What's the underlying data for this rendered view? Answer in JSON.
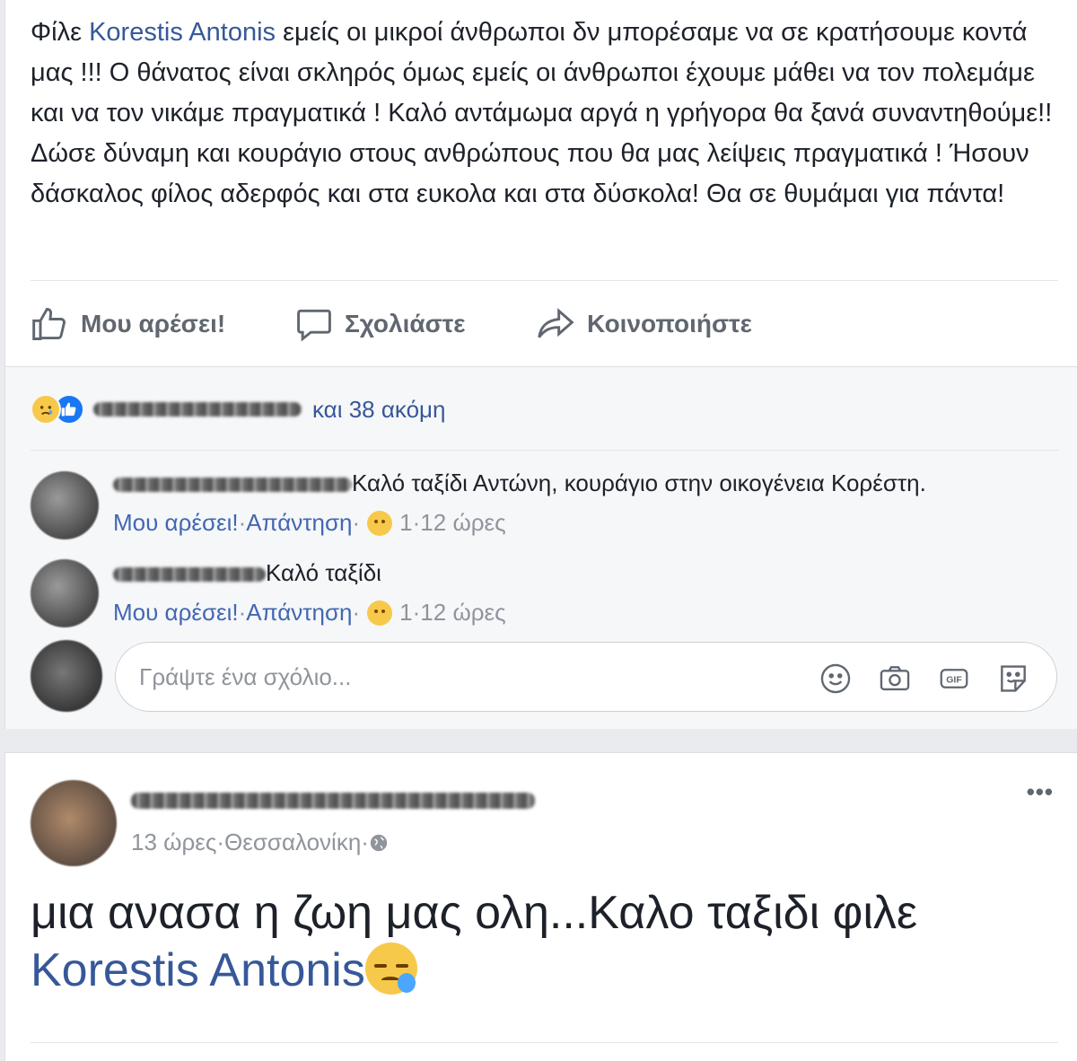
{
  "post1": {
    "text_prefix": "Φίλε ",
    "mention": "Korestis Antonis",
    "text_suffix": " εμείς οι μικροί άνθρωποι δν μπορέσαμε να σε κρατήσουμε κοντά μας !!! Ο θάνατος είναι σκληρός όμως εμείς οι άνθρωποι έχουμε μάθει να τον πολεμάμε και να τον νικάμε πραγματικά ! Καλό αντάμωμα αργά η γρήγορα θα ξανά συναντηθούμε!! Δώσε δύναμη και κουράγιο στους ανθρώπους που θα μας λείψεις πραγματικά ! Ήσουν δάσκαλος φίλος αδερφός και στα ευκολα και στα δύσκολα! Θα σε θυμάμαι για πάντα!",
    "actions": {
      "like": "Μου αρέσει!",
      "comment": "Σχολιάστε",
      "share": "Κοινοποιήστε"
    },
    "reactions_summary": "και 38 ακόμη",
    "comments": [
      {
        "text": "Καλό ταξίδι Αντώνη, κουράγιο στην οικογένεια Κορέστη.",
        "like_label": "Μου αρέσει!",
        "reply_label": "Απάντηση",
        "reaction_count": "1",
        "time": "12 ώρες"
      },
      {
        "text": "Καλό ταξίδι",
        "like_label": "Μου αρέσει!",
        "reply_label": "Απάντηση",
        "reaction_count": "1",
        "time": "12 ώρες"
      }
    ],
    "composer_placeholder": "Γράψτε ένα σχόλιο..."
  },
  "post2": {
    "time": "13 ώρες",
    "location": "Θεσσαλονίκη",
    "text": "μια ανασα η ζωη μας ολη...Καλο ταξιδι φιλε ",
    "mention": "Korestis Antonis",
    "more_label": "•••"
  },
  "separator": " · ",
  "colors": {
    "link": "#365899",
    "meta": "#90949c",
    "action": "#606770",
    "like_blue": "#1877f2",
    "sad_yellow": "#f7c94b"
  }
}
